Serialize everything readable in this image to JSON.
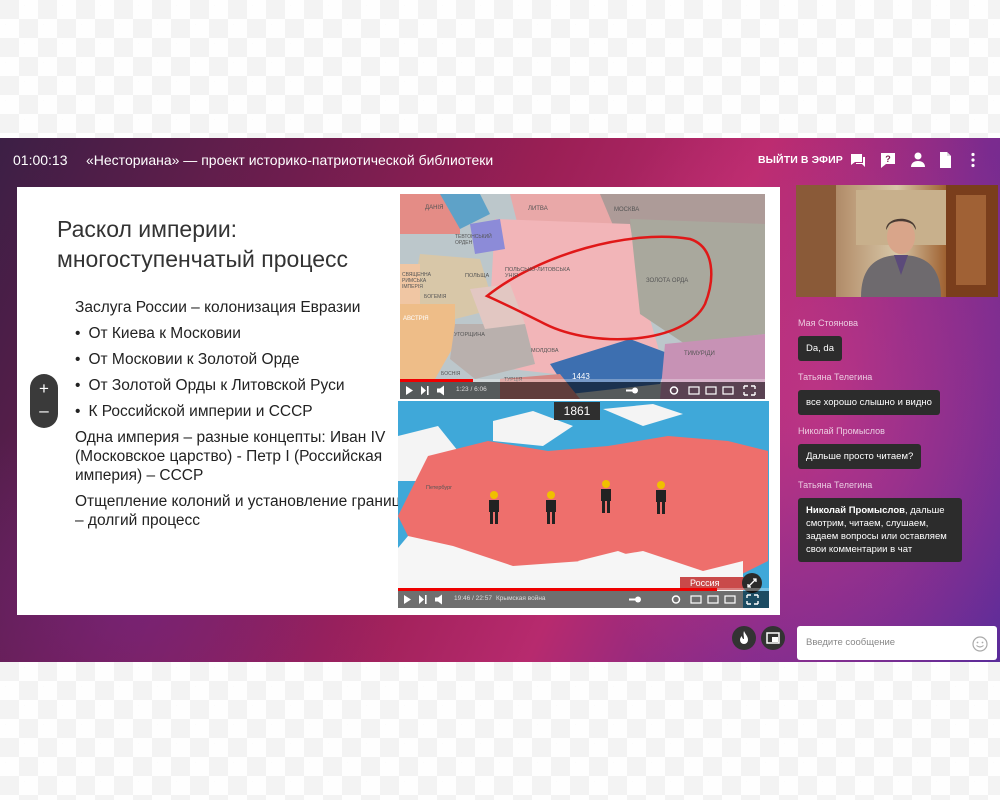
{
  "header": {
    "timer": "01:00:13",
    "title": "«Несториана» — проект историко-патриотической библиотеки",
    "leave_label": "ВЫЙТИ В ЭФИР",
    "icons": [
      "chat-icon",
      "question-icon",
      "person-icon",
      "document-icon",
      "more-icon"
    ]
  },
  "slide": {
    "title_line1": "Раскол империи:",
    "title_line2": "многоступенчатый процесс",
    "intro": "Заслуга России – колонизация Евразии",
    "bullets": [
      "От Киева к Московии",
      "От Московии к Золотой Орде",
      "От Золотой Орды к Литовской Руси",
      "К Российской империи и СССР"
    ],
    "concept": "Одна империя – разные концепты: Иван IV (Московское царство) -  Петр I (Российская империя) –  СССР",
    "closing": "Отщепление колоний и установление границ – долгий процесс"
  },
  "map1": {
    "labels": [
      "ДАНІЯ",
      "ЛИТВА",
      "МОСКВА",
      "ТЕВТОНСЬКИЙ ОРДЕН",
      "ПОЛЬСЬКО-ЛИТОВСЬКА УНІЯ",
      "ЗОЛОТА ОРДА",
      "ПОЛЬЩА",
      "СВЯЩЕННА РИМСЬКА ІМПЕРІЯ",
      "БОГЕМІЯ",
      "АВСТРІЯ",
      "УГОРЩИНА",
      "МОЛДОВА",
      "ТИМУРІДИ",
      "БОСНІЯ",
      "ТУРЦІЯ"
    ],
    "year": "1443",
    "time": "1:23 / 6:06",
    "progress": 0.2
  },
  "map2": {
    "year": "1861",
    "country_label": "Россия",
    "city_label": "Петербург",
    "time": "19:46 / 22:57",
    "chapter": "Крымская война",
    "progress": 0.86
  },
  "zoom": {
    "plus": "+",
    "minus": "–"
  },
  "chat": {
    "messages": [
      {
        "author": "Мая Стоянова",
        "text": "Da, da"
      },
      {
        "author": "Татьяна Телегина",
        "text": "все хорошо слышно и видно"
      },
      {
        "author": "Николай Промыслов",
        "text": "Дальше просто читаем?"
      },
      {
        "author": "Татьяна Телегина",
        "mention": "Николай Промыслов",
        "text": ", дальше смотрим, читаем, слушаем, задаем вопросы или оставляем свои комментарии в чат"
      }
    ],
    "input_placeholder": "Введите сообщение"
  },
  "colors": {
    "accent": "#b72a6e",
    "russia": "#ee6f6c",
    "sea": "#3fa8d9",
    "map1_pink": "#f2b5b8"
  }
}
